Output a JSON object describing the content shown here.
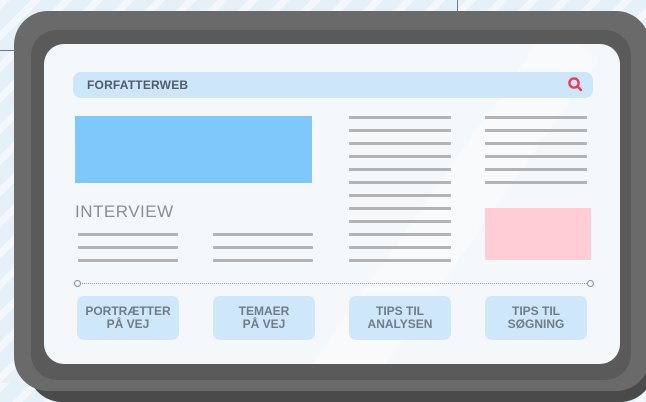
{
  "search": {
    "text": "FORFATTERWEB",
    "icon": "search-icon",
    "accent": "#ee3b4e"
  },
  "section": {
    "heading": "INTERVIEW"
  },
  "nav": {
    "buttons": [
      {
        "label": "PORTRÆTTER\nPÅ VEJ"
      },
      {
        "label": "TEMAER\nPÅ VEJ"
      },
      {
        "label": "TIPS TIL\nANALYSEN"
      },
      {
        "label": "TIPS TIL\nSØGNING"
      }
    ]
  },
  "colors": {
    "hero": "#7ec8fb",
    "ad": "#fecdd6",
    "searchbar": "#cde6fa",
    "button": "#cfe7fa"
  }
}
